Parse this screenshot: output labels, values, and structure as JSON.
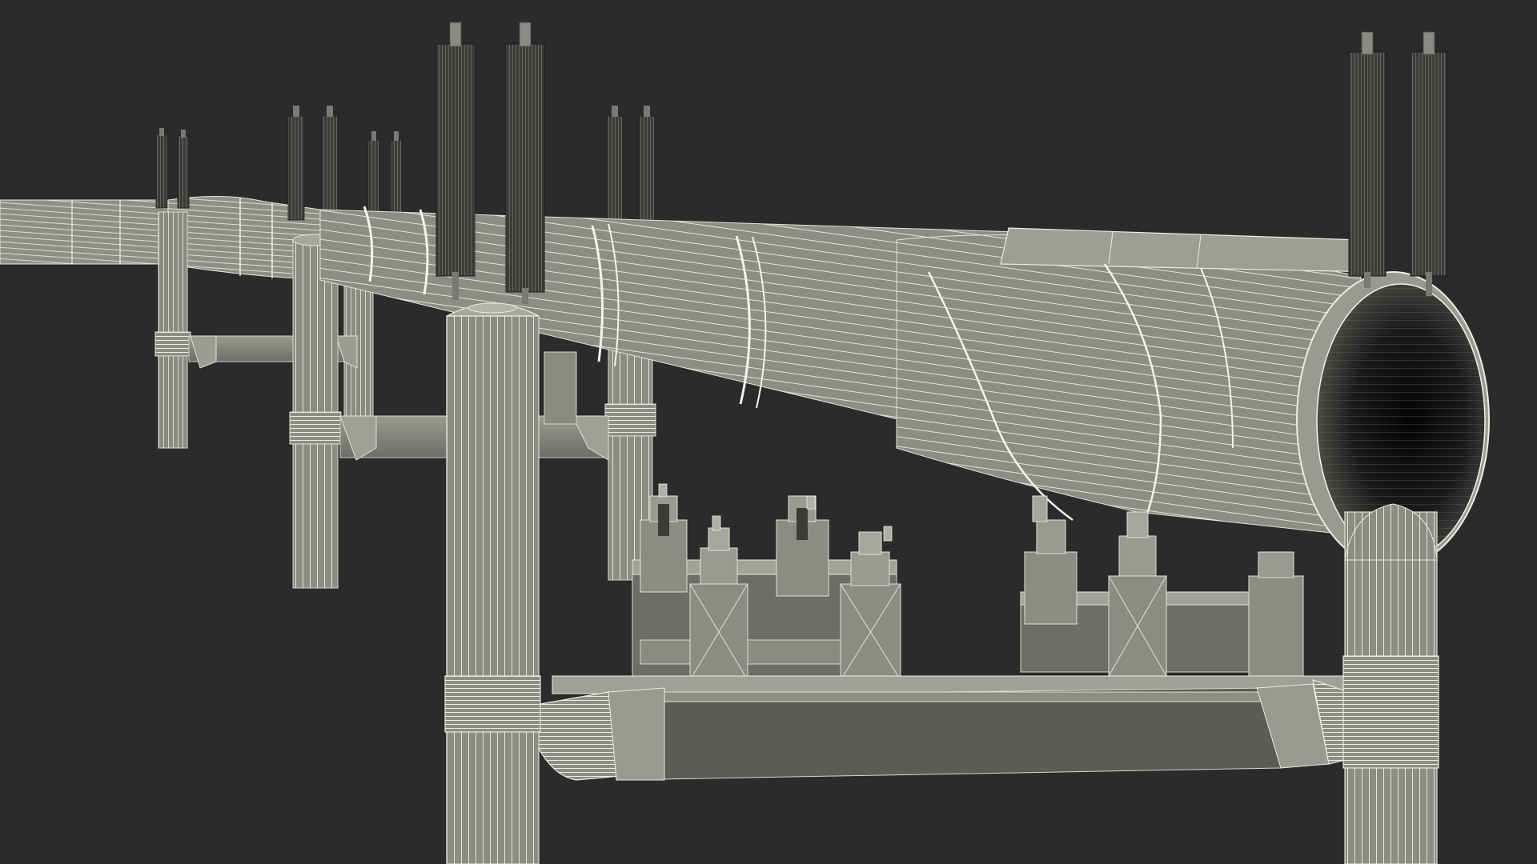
{
  "scene": {
    "background": "#2b2b2b",
    "palette": {
      "surface": "#8e8e86",
      "surface_light": "#a4a49c",
      "surface_dark": "#5e5e58",
      "wire": "#e8e8dc",
      "wire_faint": "#c9c9bd",
      "steel_dark": "#3a3a38",
      "interior": "#101010"
    }
  }
}
